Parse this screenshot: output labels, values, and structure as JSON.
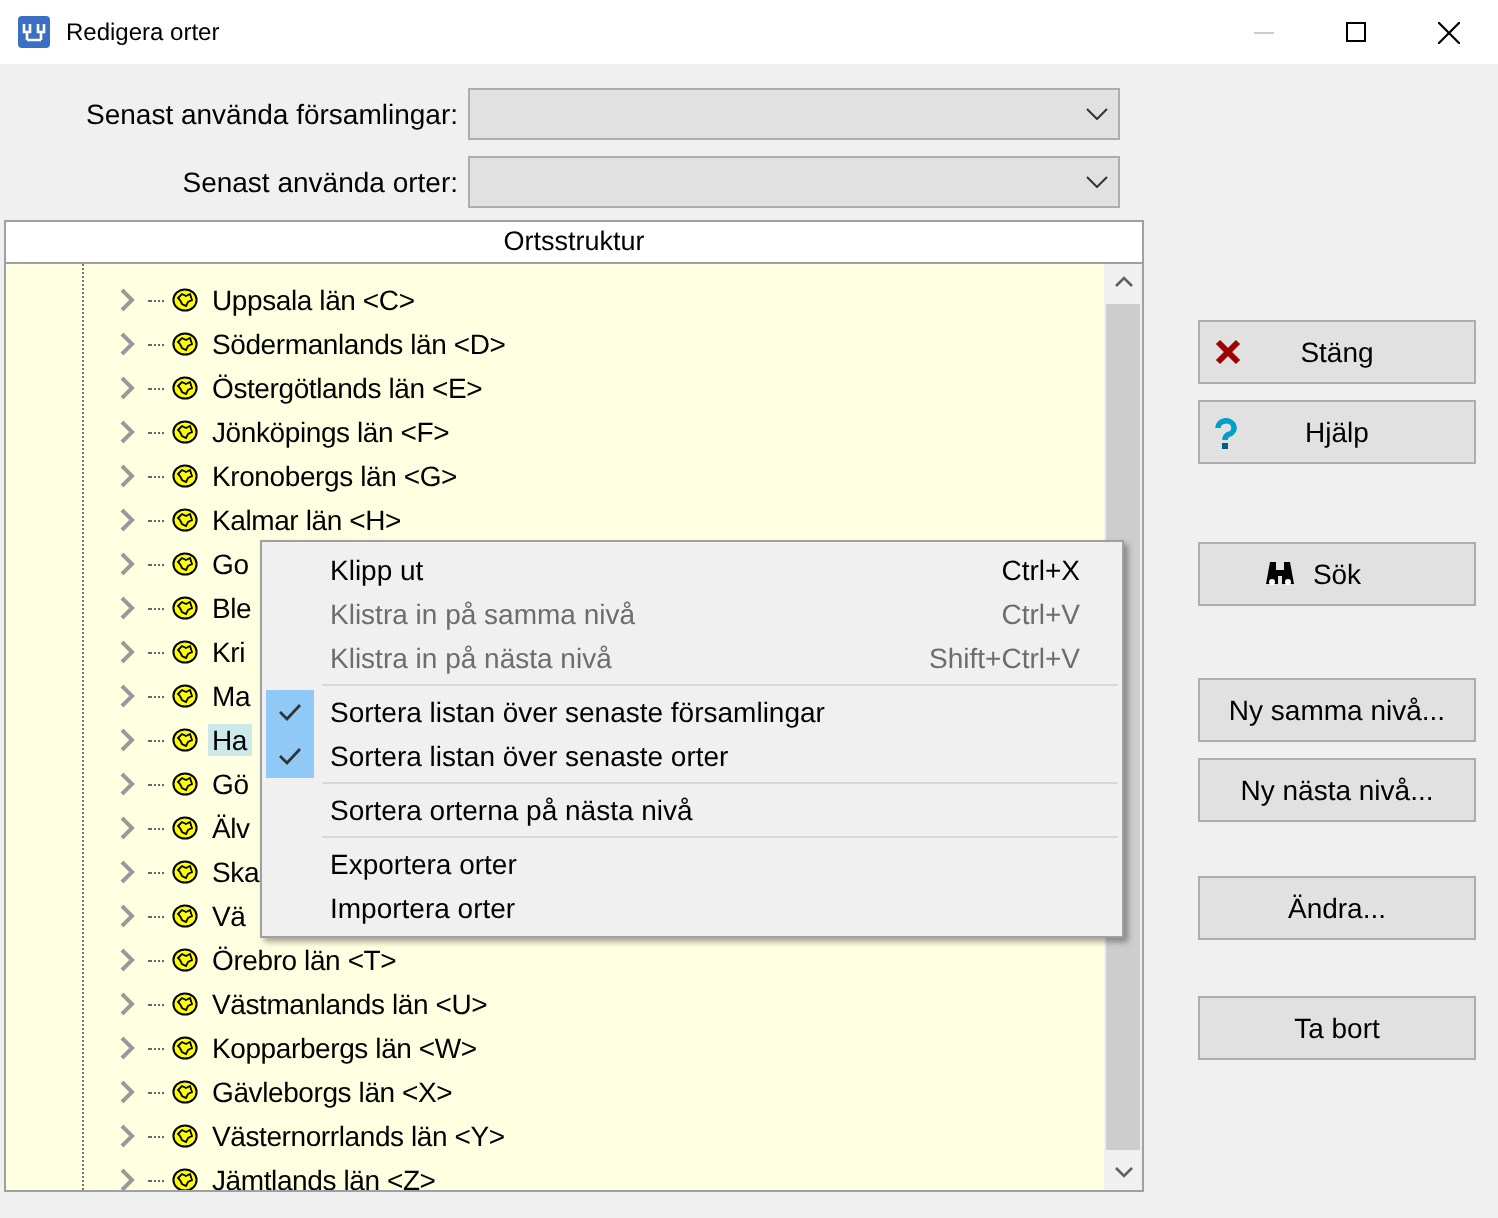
{
  "window": {
    "title": "Redigera orter"
  },
  "fields": [
    {
      "label": "Senast använda församlingar:"
    },
    {
      "label": "Senast använda orter:"
    }
  ],
  "tree": {
    "header": "Ortsstruktur",
    "items": [
      {
        "label": "Uppsala län <C>",
        "expanded": false,
        "selected": false
      },
      {
        "label": "Södermanlands län <D>",
        "expanded": false,
        "selected": false
      },
      {
        "label": "Östergötlands län <E>",
        "expanded": false,
        "selected": false
      },
      {
        "label": "Jönköpings län <F>",
        "expanded": false,
        "selected": false
      },
      {
        "label": "Kronobergs län <G>",
        "expanded": false,
        "selected": false
      },
      {
        "label": "Kalmar län <H>",
        "expanded": false,
        "selected": false
      },
      {
        "label": "Go",
        "expanded": false,
        "selected": false
      },
      {
        "label": "Ble",
        "expanded": false,
        "selected": false
      },
      {
        "label": "Kri",
        "expanded": false,
        "selected": false
      },
      {
        "label": "Ma",
        "expanded": false,
        "selected": false
      },
      {
        "label": "Ha",
        "expanded": false,
        "selected": true
      },
      {
        "label": "Gö",
        "expanded": false,
        "selected": false
      },
      {
        "label": "Älv",
        "expanded": false,
        "selected": false
      },
      {
        "label": "Ska",
        "expanded": false,
        "selected": false
      },
      {
        "label": "Vä",
        "expanded": false,
        "selected": false
      },
      {
        "label": "Örebro län <T>",
        "expanded": false,
        "selected": false
      },
      {
        "label": "Västmanlands län <U>",
        "expanded": false,
        "selected": false
      },
      {
        "label": "Kopparbergs län <W>",
        "expanded": false,
        "selected": false
      },
      {
        "label": "Gävleborgs län <X>",
        "expanded": false,
        "selected": false
      },
      {
        "label": "Västernorrlands län <Y>",
        "expanded": false,
        "selected": false
      },
      {
        "label": "Jämtlands län <Z>",
        "expanded": false,
        "selected": false
      }
    ]
  },
  "buttons": [
    {
      "label": "Stäng",
      "kind": "close"
    },
    {
      "label": "Hjälp",
      "kind": "help"
    },
    {
      "label": "Sök",
      "kind": "search"
    },
    {
      "label": "Ny samma nivå...",
      "kind": "plain"
    },
    {
      "label": "Ny nästa nivå...",
      "kind": "plain"
    },
    {
      "label": "Ändra...",
      "kind": "plain"
    },
    {
      "label": "Ta bort",
      "kind": "plain"
    }
  ],
  "context_menu": [
    {
      "kind": "item",
      "label": "Klipp ut",
      "shortcut": "Ctrl+X",
      "disabled": false,
      "checked": false
    },
    {
      "kind": "item",
      "label": "Klistra in på samma nivå",
      "shortcut": "Ctrl+V",
      "disabled": true,
      "checked": false
    },
    {
      "kind": "item",
      "label": "Klistra in på nästa nivå",
      "shortcut": "Shift+Ctrl+V",
      "disabled": true,
      "checked": false
    },
    {
      "kind": "separator"
    },
    {
      "kind": "item",
      "label": "Sortera listan över senaste församlingar",
      "disabled": false,
      "checked": true
    },
    {
      "kind": "item",
      "label": "Sortera listan över senaste orter",
      "disabled": false,
      "checked": true
    },
    {
      "kind": "separator"
    },
    {
      "kind": "item",
      "label": "Sortera orterna på nästa nivå",
      "disabled": false,
      "checked": false
    },
    {
      "kind": "separator"
    },
    {
      "kind": "item",
      "label": "Exportera orter",
      "disabled": false,
      "checked": false
    },
    {
      "kind": "item",
      "label": "Importera orter",
      "disabled": false,
      "checked": false
    }
  ]
}
